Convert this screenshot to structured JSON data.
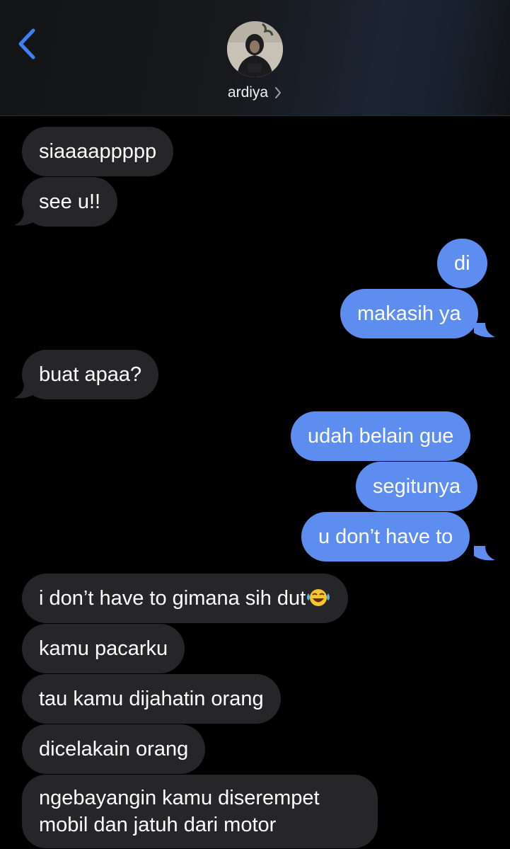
{
  "header": {
    "contact_name": "ardiya",
    "back_icon": "chevron-left-icon",
    "accent": "#3b82f6"
  },
  "messages": [
    {
      "dir": "in",
      "text": "siaaaappppp"
    },
    {
      "dir": "in",
      "text": "see u!!"
    },
    {
      "dir": "out",
      "text": "di"
    },
    {
      "dir": "out",
      "text": "makasih ya"
    },
    {
      "dir": "in",
      "text": "buat apaa?"
    },
    {
      "dir": "out",
      "text": "udah belain gue"
    },
    {
      "dir": "out",
      "text": "segitunya"
    },
    {
      "dir": "out",
      "text": "u don’t have to"
    },
    {
      "dir": "in",
      "text": "i don’t have to gimana sih dut",
      "emoji": "tears-of-joy-emoji"
    },
    {
      "dir": "in",
      "text": "kamu pacarku"
    },
    {
      "dir": "in",
      "text": "tau kamu dijahatin orang"
    },
    {
      "dir": "in",
      "text": "dicelakain orang"
    },
    {
      "dir": "in",
      "text": "ngebayangin kamu diserempet mobil dan jatuh dari motor"
    }
  ],
  "colors": {
    "incoming_bubble": "#262629",
    "outgoing_bubble": "#5e8df0",
    "background": "#000000"
  }
}
